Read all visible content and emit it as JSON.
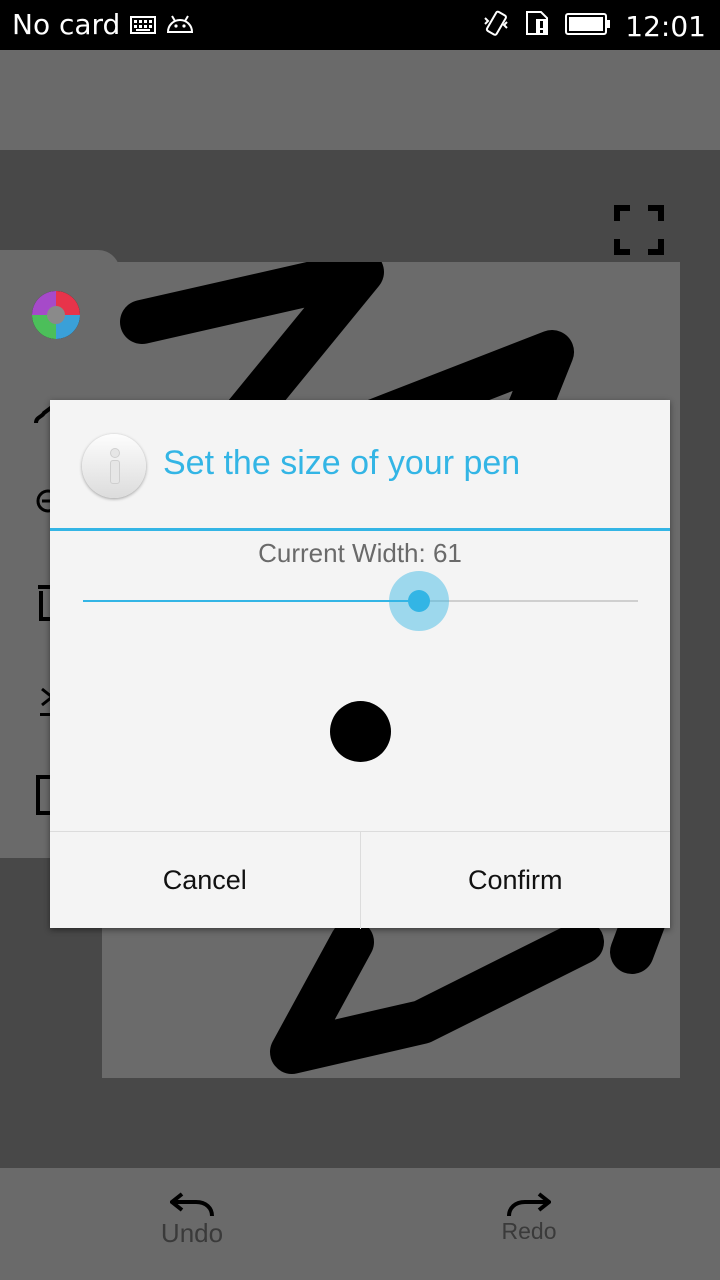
{
  "status_bar": {
    "carrier": "No card",
    "time": "12:01",
    "icons": [
      "keyboard-icon",
      "android-debug-icon",
      "vibrate-icon",
      "sim-alert-icon",
      "battery-icon"
    ]
  },
  "dialog": {
    "title": "Set the size of your pen",
    "icon": "info-icon",
    "width_label": "Current Width:  61",
    "width_value": 61,
    "slider_fraction": 0.606,
    "cancel_label": "Cancel",
    "confirm_label": "Confirm"
  },
  "toolbar": {
    "undo_label": "Undo",
    "redo_label": "Redo"
  },
  "tools": [
    "color-wheel-icon",
    "brush-icon",
    "eraser-icon",
    "trash-icon",
    "download-icon",
    "frame-icon"
  ],
  "colors": {
    "accent": "#33b5e5",
    "dialog_bg": "#f4f4f4"
  }
}
